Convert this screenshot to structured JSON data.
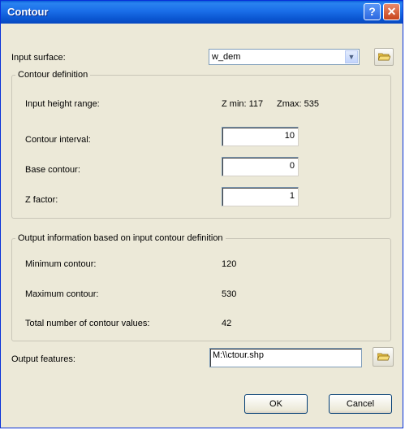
{
  "dialog": {
    "title": "Contour",
    "help_glyph": "?",
    "close_glyph": "✕"
  },
  "input_surface": {
    "label": "Input surface:",
    "value": "w_dem"
  },
  "contour_definition": {
    "legend": "Contour definition",
    "height_range_label": "Input height range:",
    "zmin_text": "Z min: 117",
    "zmax_text": "Zmax: 535",
    "interval_label": "Contour interval:",
    "interval_value": "10",
    "base_label": "Base contour:",
    "base_value": "0",
    "zfactor_label": "Z factor:",
    "zfactor_value": "1"
  },
  "output_info": {
    "legend": "Output information based on input contour definition",
    "min_label": "Minimum contour:",
    "min_value": "120",
    "max_label": "Maximum contour:",
    "max_value": "530",
    "total_label": "Total number of contour values:",
    "total_value": "42"
  },
  "output_features": {
    "label": "Output features:",
    "value": "M:\\\\ctour.shp"
  },
  "buttons": {
    "ok": "OK",
    "cancel": "Cancel"
  },
  "icons": {
    "help": "help-icon",
    "close": "close-icon",
    "open_folder": "open-folder-icon",
    "dropdown": "chevron-down-icon"
  },
  "colors": {
    "titlebar": "#0a5fd7",
    "window_bg": "#ece9d8",
    "close_button": "#c8441c"
  }
}
